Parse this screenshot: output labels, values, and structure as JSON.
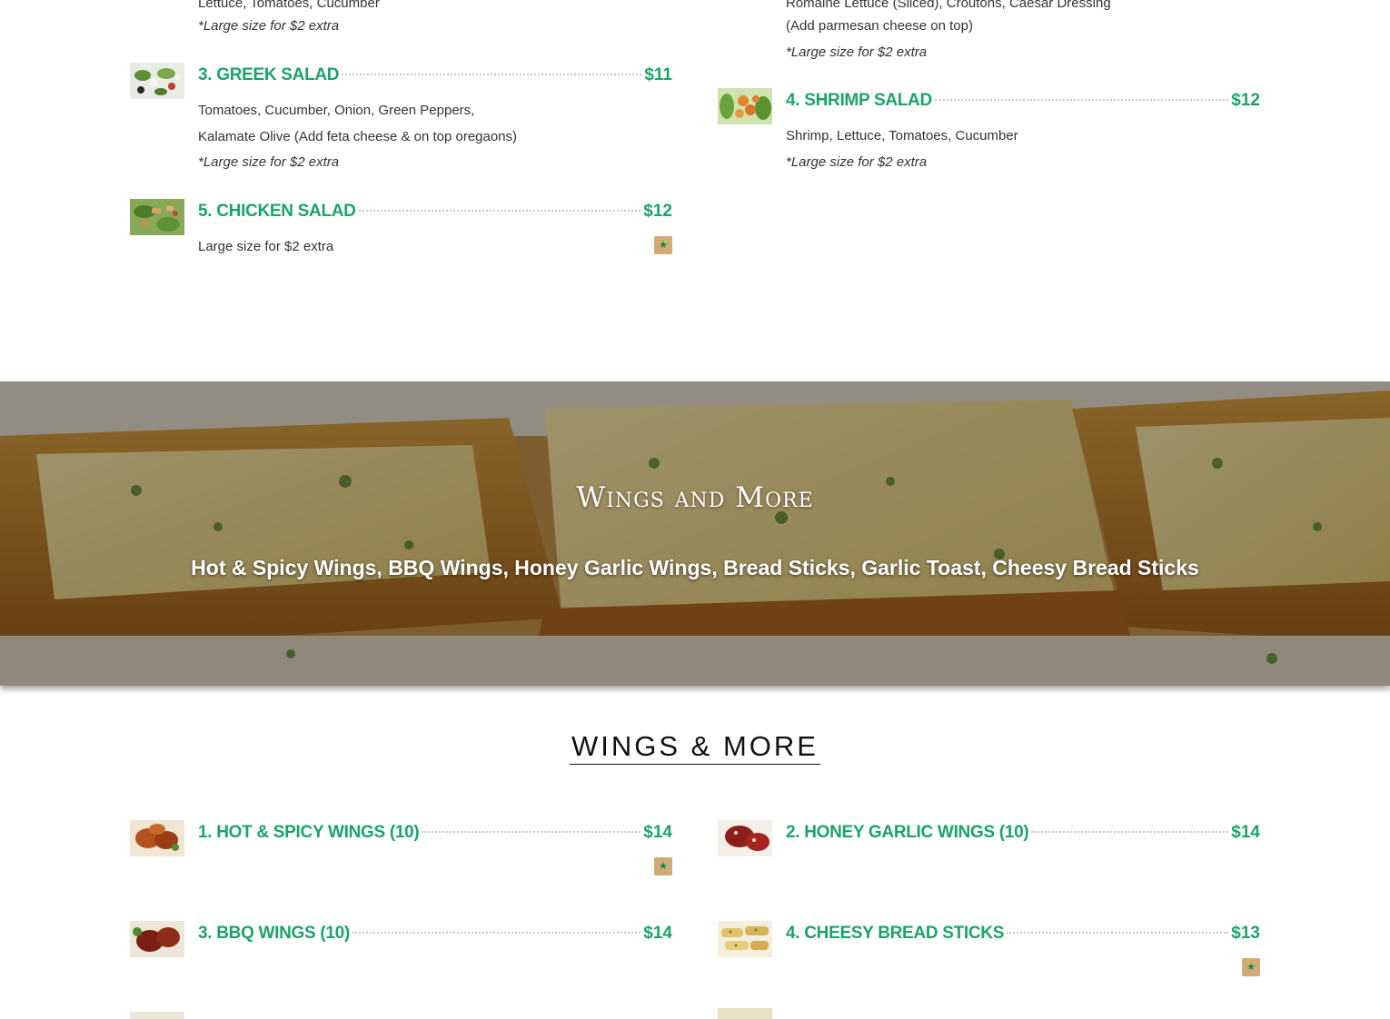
{
  "salads": {
    "top_left_desc": "Lettuce, Tomatoes, Cucumber",
    "top_left_note": "*Large size for $2 extra",
    "top_right_desc_1": "Romaine Lettuce (Sliced), Croutons, Caesar Dressing",
    "top_right_desc_2": "(Add parmesan cheese on top)",
    "top_right_note": "*Large size for $2 extra",
    "items": [
      {
        "title": "3. GREEK SALAD",
        "price": "$11",
        "desc_1": "Tomatoes, Cucumber, Onion, Green Peppers,",
        "desc_2": "Kalamate Olive (Add feta cheese & on top oregaons)",
        "note": "*Large size for $2 extra"
      },
      {
        "title": "4. SHRIMP SALAD",
        "price": "$12",
        "desc_1": "Shrimp, Lettuce, Tomatoes, Cucumber",
        "note": "*Large size for $2 extra"
      },
      {
        "title": "5. CHICKEN SALAD",
        "price": "$12",
        "desc_1": "Large size for $2 extra"
      }
    ]
  },
  "banner": {
    "title": "Wings and More",
    "subtitle": "Hot & Spicy Wings, BBQ Wings, Honey Garlic Wings, Bread Sticks, Garlic Toast, Cheesy Bread Sticks"
  },
  "wings": {
    "heading": "WINGS & MORE",
    "items": [
      {
        "title": "1. HOT & SPICY WINGS (10)",
        "price": "$14"
      },
      {
        "title": "2. HONEY GARLIC WINGS (10)",
        "price": "$14"
      },
      {
        "title": "3. BBQ WINGS (10)",
        "price": "$14"
      },
      {
        "title": "4. CHEESY BREAD STICKS",
        "price": "$13"
      }
    ]
  },
  "icons": {
    "featured_badge": "star-icon"
  },
  "colors": {
    "accent_green": "#1aa468",
    "badge_tan": "#d2aa76"
  }
}
